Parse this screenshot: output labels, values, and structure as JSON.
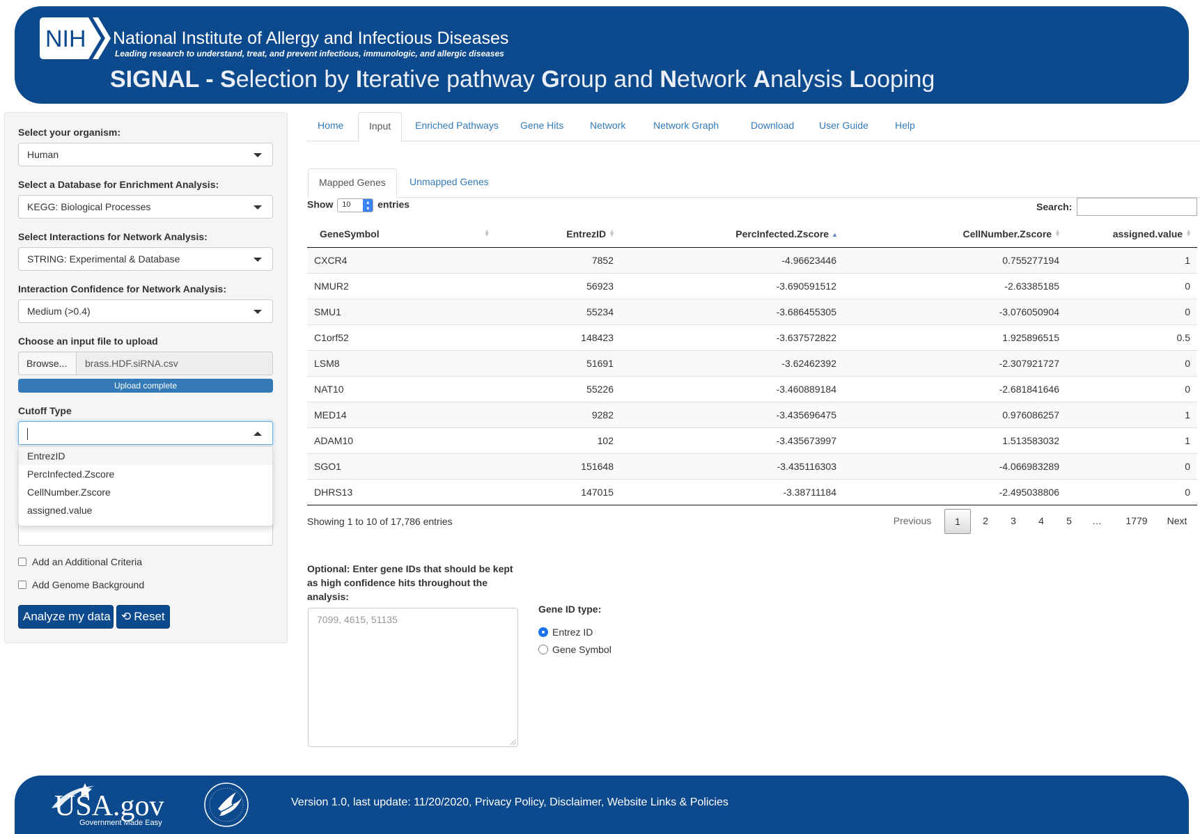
{
  "header": {
    "logo_text": "NIH",
    "institute_name": "National Institute of Allergy and Infectious Diseases",
    "tagline": "Leading research to understand, treat, and prevent infectious, immunologic, and allergic diseases",
    "title_parts": [
      {
        "text": "SIGNAL - ",
        "bold": true
      },
      {
        "text": "S",
        "bold": true
      },
      {
        "text": "election by ",
        "bold": false
      },
      {
        "text": "I",
        "bold": true
      },
      {
        "text": "terative pathway ",
        "bold": false
      },
      {
        "text": "G",
        "bold": true
      },
      {
        "text": "roup and ",
        "bold": false
      },
      {
        "text": "N",
        "bold": true
      },
      {
        "text": "etwork ",
        "bold": false
      },
      {
        "text": "A",
        "bold": true
      },
      {
        "text": "nalysis ",
        "bold": false
      },
      {
        "text": "L",
        "bold": true
      },
      {
        "text": "ooping",
        "bold": false
      }
    ]
  },
  "sidebar": {
    "organism_label": "Select your organism:",
    "organism_value": "Human",
    "database_label": "Select a Database for Enrichment Analysis:",
    "database_value": "KEGG: Biological Processes",
    "interactions_label": "Select Interactions for Network Analysis:",
    "interactions_value": "STRING: Experimental & Database",
    "confidence_label": "Interaction Confidence for Network Analysis:",
    "confidence_value": "Medium (>0.4)",
    "file_label": "Choose an input file to upload",
    "browse_label": "Browse...",
    "file_name": "brass.HDF.siRNA.csv",
    "upload_status": "Upload complete",
    "upload_progress": 1.0,
    "cutoff_label": "Cutoff Type",
    "cutoff_value": "",
    "cutoff_options": [
      "EntrezID",
      "PercInfected.Zscore",
      "CellNumber.Zscore",
      "assigned.value"
    ],
    "additional_criteria_label": "Add an Additional Criteria",
    "genome_background_label": "Add Genome Background",
    "analyze_label": "Analyze my data",
    "reset_label": "Reset"
  },
  "main_tabs": [
    "Home",
    "Input",
    "Enriched Pathways",
    "Gene Hits",
    "Network",
    "Network Graph",
    "Download",
    "User Guide",
    "Help"
  ],
  "main_tab_active": "Input",
  "sub_tabs": [
    "Mapped Genes",
    "Unmapped Genes"
  ],
  "sub_tab_active": "Mapped Genes",
  "table": {
    "show_label": "Show",
    "entries_label": "entries",
    "length_value": "10",
    "search_label": "Search:",
    "columns": [
      "GeneSymbol",
      "EntrezID",
      "PercInfected.Zscore",
      "CellNumber.Zscore",
      "assigned.value"
    ],
    "rows": [
      [
        "CXCR4",
        "7852",
        "-4.96623446",
        "0.755277194",
        "1"
      ],
      [
        "NMUR2",
        "56923",
        "-3.690591512",
        "-2.63385185",
        "0"
      ],
      [
        "SMU1",
        "55234",
        "-3.686455305",
        "-3.076050904",
        "0"
      ],
      [
        "C1orf52",
        "148423",
        "-3.637572822",
        "1.925896515",
        "0.5"
      ],
      [
        "LSM8",
        "51691",
        "-3.62462392",
        "-2.307921727",
        "0"
      ],
      [
        "NAT10",
        "55226",
        "-3.460889184",
        "-2.681841646",
        "0"
      ],
      [
        "MED14",
        "9282",
        "-3.435696475",
        "0.976086257",
        "1"
      ],
      [
        "ADAM10",
        "102",
        "-3.435673997",
        "1.513583032",
        "1"
      ],
      [
        "SGO1",
        "151648",
        "-3.435116303",
        "-4.066983289",
        "0"
      ],
      [
        "DHRS13",
        "147015",
        "-3.38711184",
        "-2.495038806",
        "0"
      ]
    ],
    "info": "Showing 1 to 10 of 17,786 entries",
    "pagination": [
      "Previous",
      "1",
      "2",
      "3",
      "4",
      "5",
      "…",
      "1779",
      "Next"
    ],
    "current_page": "1"
  },
  "optional": {
    "label": "Optional: Enter gene IDs that should be kept as high confidence hits throughout the analysis:",
    "placeholder": "7099, 4615, 51135",
    "gene_id_type_label": "Gene ID type:",
    "options": [
      "Entrez ID",
      "Gene Symbol"
    ],
    "selected": "Entrez ID"
  },
  "footer": {
    "usa_logo": "USA.gov",
    "usa_tagline": "Government Made Easy",
    "text": "Version 1.0, last update: 11/20/2020, Privacy Policy, Disclaimer, Website Links & Policies"
  },
  "colors": {
    "brand": "#0c4a8d",
    "link": "#337ab7",
    "progress": "#337ab7"
  }
}
